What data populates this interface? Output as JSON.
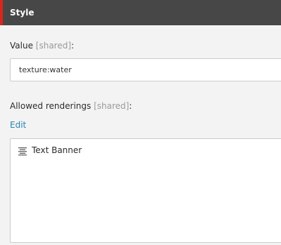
{
  "colors": {
    "header_bg": "#474747",
    "accent": "#d9261c",
    "link": "#2b83b3",
    "shared_tag": "#9a9a9a",
    "page_bg": "#f3f3f3"
  },
  "section": {
    "title": "Style"
  },
  "value_field": {
    "label": "Value",
    "shared_tag": "[shared]",
    "colon": ":",
    "value": "texture:water"
  },
  "renderings_field": {
    "label": "Allowed renderings",
    "shared_tag": "[shared]",
    "colon": ":",
    "edit_label": "Edit",
    "items": [
      {
        "icon": "text-align-center-icon",
        "label": "Text Banner"
      }
    ]
  }
}
